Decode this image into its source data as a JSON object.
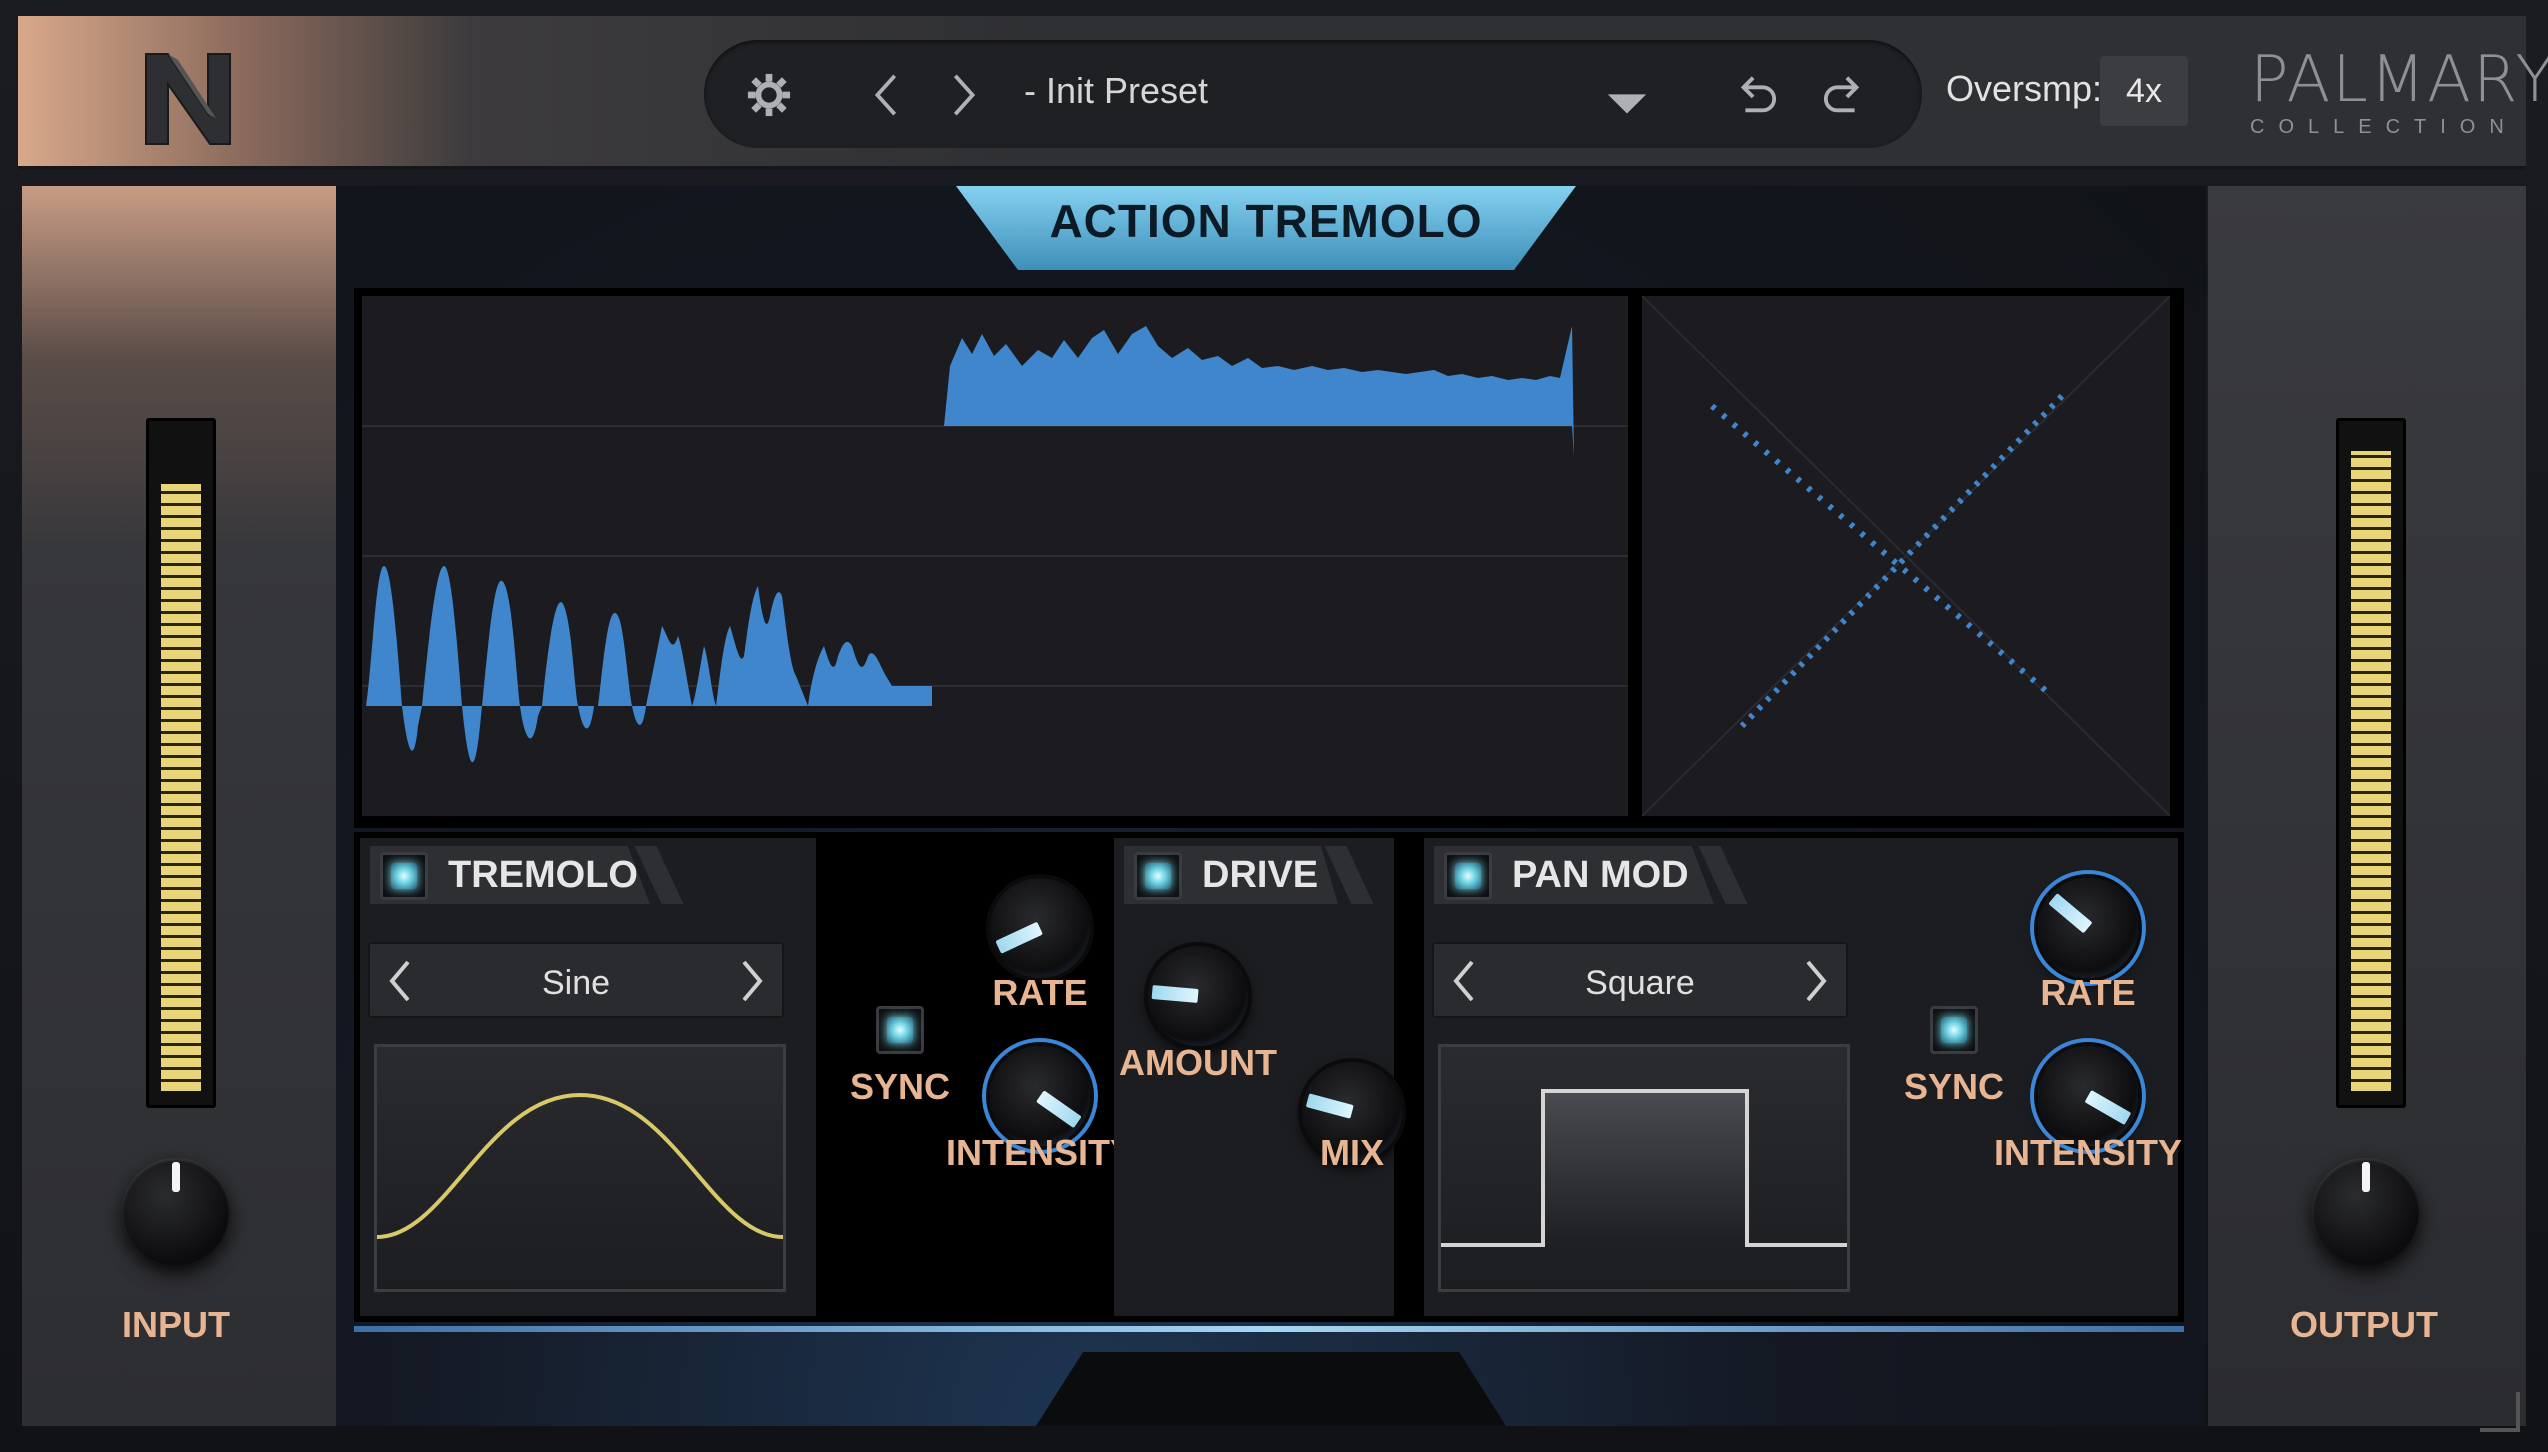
{
  "topbar": {
    "preset_name": "- Init Preset",
    "oversampling_label": "Oversmp:",
    "oversampling_value": "4x",
    "brand_main": "PALMARY",
    "brand_sub": "COLLECTION",
    "icons": [
      "n-logo-icon",
      "gear-icon",
      "chevron-left-icon",
      "chevron-right-icon",
      "dropdown-arrow-icon",
      "undo-icon",
      "redo-icon"
    ]
  },
  "plugin": {
    "title": "ACTION TREMOLO",
    "accent": "#5fb4e0"
  },
  "input": {
    "label": "INPUT",
    "meter_level": 0.92
  },
  "output": {
    "label": "OUTPUT",
    "meter_level": 0.97
  },
  "tremolo": {
    "label": "TREMOLO",
    "enabled": true,
    "shape": "Sine",
    "rate_label": "RATE",
    "sync_label": "SYNC",
    "intensity_label": "INTENSITY"
  },
  "drive": {
    "label": "DRIVE",
    "enabled": true,
    "amount_label": "AMOUNT",
    "mix_label": "MIX"
  },
  "panmod": {
    "label": "PAN MOD",
    "enabled": true,
    "shape": "Square",
    "rate_label": "RATE",
    "sync_label": "SYNC",
    "intensity_label": "INTENSITY"
  },
  "colors": {
    "label": "#e8b592",
    "wave": "#3f86cc",
    "meter": "#e8d57a",
    "sine": "#d8c86a"
  }
}
